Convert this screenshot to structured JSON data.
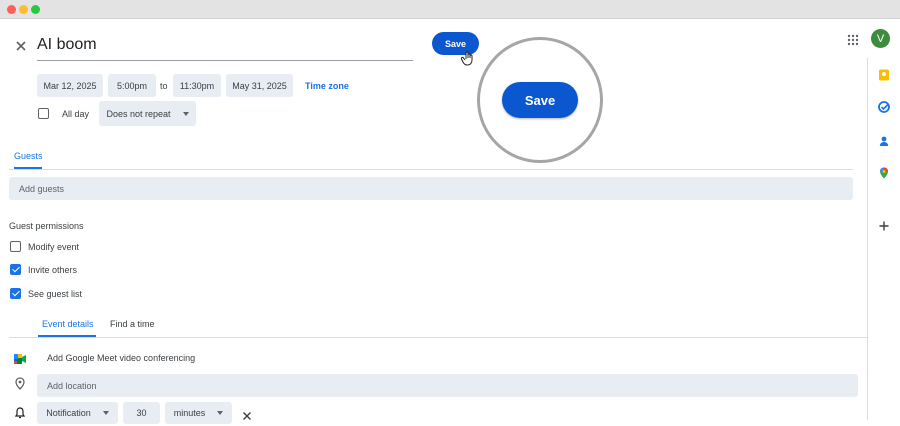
{
  "event": {
    "title": "AI boom",
    "save_label": "Save",
    "save_zoom_label": "Save"
  },
  "datetime": {
    "start_date": "Mar 12, 2025",
    "start_time": "5:00pm",
    "to": "to",
    "end_time": "11:30pm",
    "end_date": "May 31, 2025",
    "timezone": "Time zone",
    "allday": "All day",
    "repeat": "Does not repeat"
  },
  "guests": {
    "tab": "Guests",
    "placeholder": "Add guests",
    "permissions_title": "Guest permissions",
    "permissions": [
      {
        "label": "Modify event",
        "checked": false
      },
      {
        "label": "Invite others",
        "checked": true
      },
      {
        "label": "See guest list",
        "checked": true
      }
    ]
  },
  "details": {
    "tab_event": "Event details",
    "tab_find": "Find a time",
    "meet": "Add Google Meet video conferencing",
    "location": "Add location",
    "notif_type": "Notification",
    "notif_value": "30",
    "notif_unit": "minutes"
  },
  "account": {
    "avatar_letter": "V",
    "avatar_color": "#3d8c3d"
  },
  "colors": {
    "accent": "#1a73e8",
    "save": "#0b57d0"
  }
}
